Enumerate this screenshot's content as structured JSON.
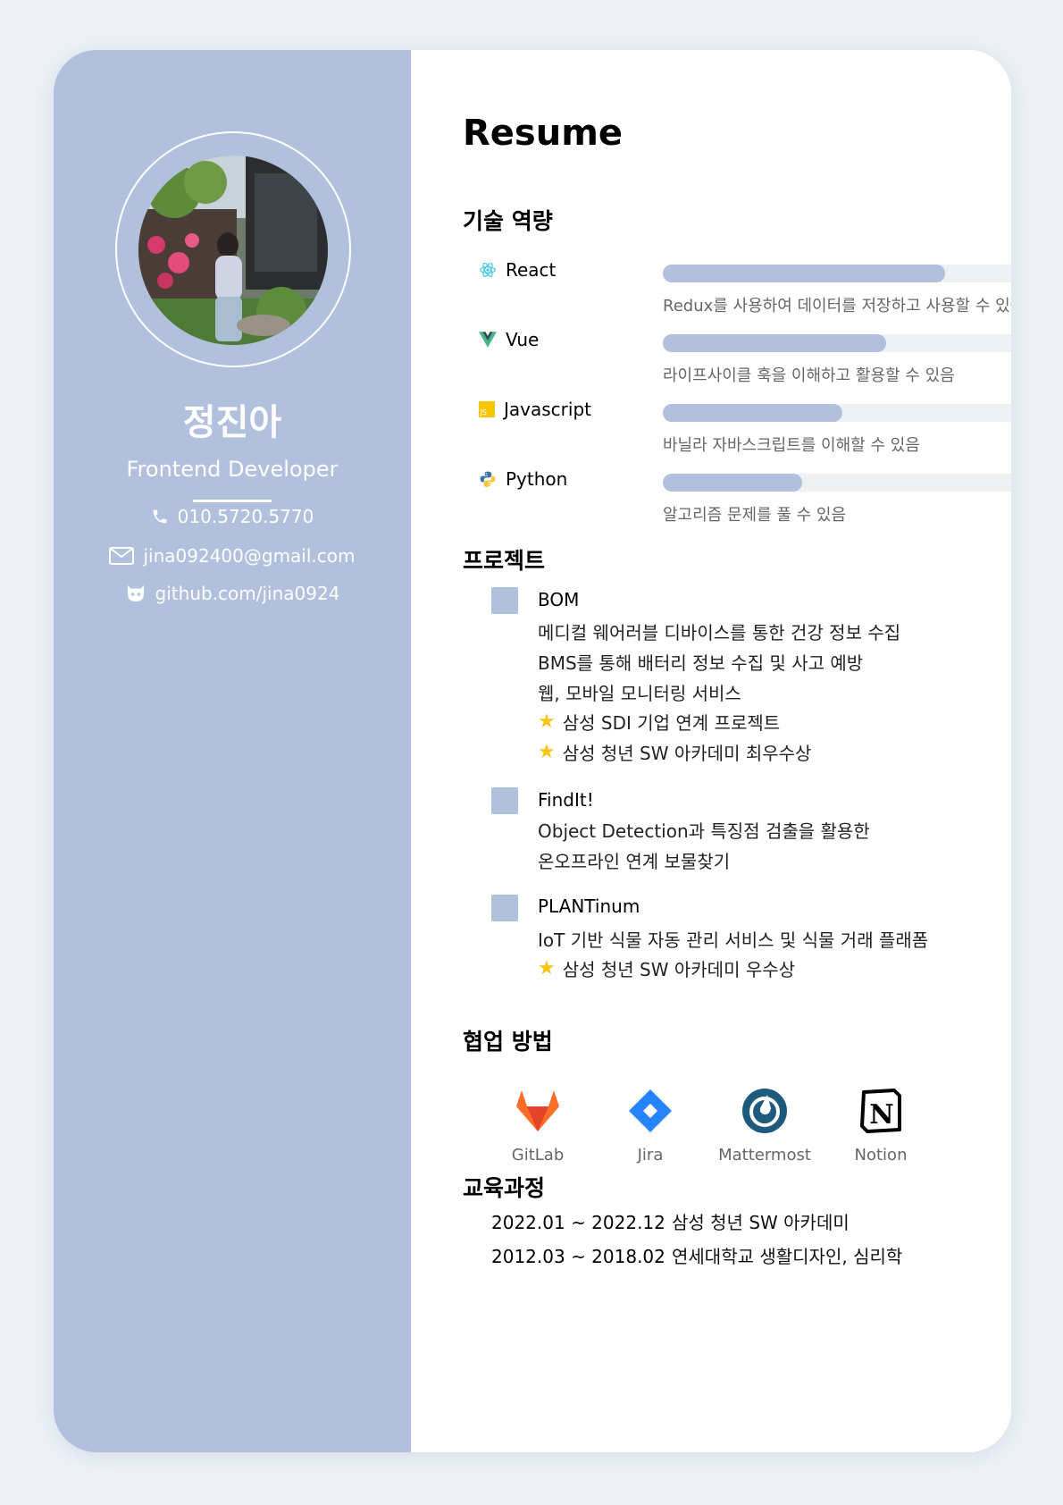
{
  "profile": {
    "name": "정진아",
    "role": "Frontend Developer",
    "phone": "010.5720.5770",
    "email": "jina092400@gmail.com",
    "github": "github.com/jina0924"
  },
  "resume_title": "Resume",
  "sections": {
    "skills": "기술 역량",
    "projects": "프로젝트",
    "collab": "협업 방법",
    "education": "교육과정"
  },
  "skills": [
    {
      "name": "React",
      "icon": "react-icon",
      "level": 0.77,
      "desc": "Redux를 사용하여 데이터를 저장하고 사용할 수 있음"
    },
    {
      "name": "Vue",
      "icon": "vue-icon",
      "level": 0.61,
      "desc": "라이프사이클 훅을 이해하고 활용할 수 있음"
    },
    {
      "name": "Javascript",
      "icon": "javascript-icon",
      "level": 0.49,
      "desc": "바닐라 자바스크립트를 이해할 수 있음"
    },
    {
      "name": "Python",
      "icon": "python-icon",
      "level": 0.38,
      "desc": "알고리즘 문제를 풀 수 있음"
    }
  ],
  "projects": [
    {
      "title": "BOM",
      "lines": [
        "메디컬 웨어러블 디바이스를 통한 건강 정보 수집",
        "BMS를 통해 배터리 정보 수집 및 사고 예방",
        "웹, 모바일 모니터링 서비스"
      ],
      "awards": [
        "삼성 SDI 기업 연계 프로젝트",
        "삼성 청년 SW 아카데미 최우수상"
      ]
    },
    {
      "title": "FindIt!",
      "lines": [
        "Object Detection과 특징점 검출을 활용한",
        "온오프라인 연계 보물찾기"
      ],
      "awards": []
    },
    {
      "title": "PLANTinum",
      "lines": [
        "IoT 기반 식물 자동 관리 서비스 및 식물 거래 플래폼"
      ],
      "awards": [
        "삼성 청년 SW 아카데미 우수상"
      ]
    }
  ],
  "tools": [
    {
      "name": "GitLab",
      "icon": "gitlab-icon"
    },
    {
      "name": "Jira",
      "icon": "jira-icon"
    },
    {
      "name": "Mattermost",
      "icon": "mattermost-icon"
    },
    {
      "name": "Notion",
      "icon": "notion-icon"
    }
  ],
  "education": [
    {
      "period": "2022.01 ~ 2022.12",
      "school": "삼성 청년 SW 아카데미"
    },
    {
      "period": "2012.03 ~ 2018.02",
      "school": "연세대학교 생활디자인, 심리학"
    }
  ],
  "colors": {
    "accent": "#b1c0dc",
    "track": "#eef0f2",
    "star": "#f5c518"
  }
}
